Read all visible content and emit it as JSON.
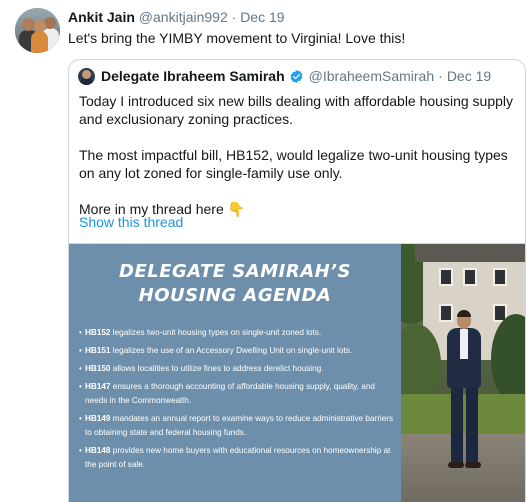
{
  "tweet": {
    "author_name": "Ankit Jain",
    "author_handle": "@ankitjain992",
    "separator": "·",
    "date": "Dec 19",
    "text": "Let's bring the YIMBY movement to Virginia! Love this!"
  },
  "quoted_tweet": {
    "author_name": "Delegate Ibraheem Samirah",
    "verified": true,
    "author_handle": "@IbraheemSamirah",
    "separator": "·",
    "date": "Dec 19",
    "paragraphs": [
      "Today I introduced six new bills dealing with affordable housing supply and exclusionary zoning practices.",
      "The most impactful bill, HB152, would legalize two-unit housing types on any lot zoned for single-family use only.",
      "More in my thread here 👇"
    ],
    "show_thread_label": "Show this thread",
    "media": {
      "title_line1": "DELEGATE SAMIRAH’S",
      "title_line2": "HOUSING AGENDA",
      "bullet_glyph": "•",
      "items": [
        {
          "code": "HB152",
          "text": " legalizes two-unit housing types on single-unit zoned lots."
        },
        {
          "code": "HB151",
          "text": " legalizes the use of an Accessory Dwelling Unit on single-unit lots."
        },
        {
          "code": "HB150",
          "text": " allows localities to utilize fines to address derelict housing."
        },
        {
          "code": "HB147",
          "text": " ensures a thorough accounting of affordable housing supply, quality, and needs in the Commonwealth."
        },
        {
          "code": "HB149",
          "text": " mandates an annual report to examine ways to reduce administrative barriers to obtaining state and federal housing funds."
        },
        {
          "code": "HB148",
          "text": " provides new home buyers with educational resources on homeownership at the point of sale."
        }
      ]
    }
  },
  "colors": {
    "link_blue": "#1b95e0",
    "verified_blue": "#1da1f2",
    "graphic_background": "#6d8fab",
    "secondary_text": "#657786"
  },
  "icons": {
    "verified": "verified-badge-icon"
  }
}
